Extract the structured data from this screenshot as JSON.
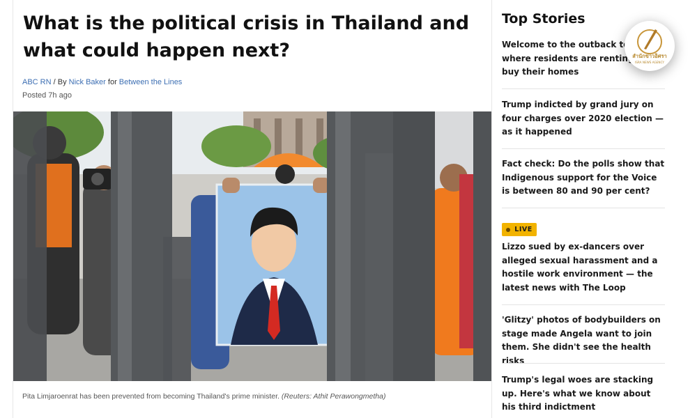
{
  "article": {
    "headline": "What is the political crisis in Thailand and what could happen next?",
    "source": "ABC RN",
    "by_prefix": "/ By",
    "author": "Nick Baker",
    "for_word": "for",
    "program": "Between the Lines",
    "posted": "Posted 7h ago",
    "caption": "Pita Limjaroenrat has been prevented from becoming Thailand's prime minister.",
    "credit": "(Reuters: Athit Perawongmetha)"
  },
  "sidebar": {
    "title": "Top Stories",
    "live_label": "LIVE",
    "stories": [
      {
        "title": "Welcome to the outback town where residents are renting to buy their homes"
      },
      {
        "title": "Trump indicted by grand jury on four charges over 2020 election — as it happened"
      },
      {
        "title": "Fact check: Do the polls show that Indigenous support for the Voice is between 80 and 90 per cent?"
      },
      {
        "title": "Lizzo sued by ex-dancers over alleged sexual harassment and a hostile work environment — the latest news with The Loop"
      },
      {
        "title": "'Glitzy' photos of bodybuilders on stage made Angela want to join them. She didn't see the health risks"
      },
      {
        "title": "Trump's legal woes are stacking up. Here's what we know about his third indictment"
      }
    ]
  },
  "watermark": {
    "text_thai": "สำนักข่าวอิศรา",
    "text_en": "ISRA NEWS AGENCY"
  },
  "colors": {
    "link": "#3d6fb3",
    "live": "#f2b300",
    "shirt_orange": "#f07a1e",
    "tie_red": "#d42a22"
  }
}
